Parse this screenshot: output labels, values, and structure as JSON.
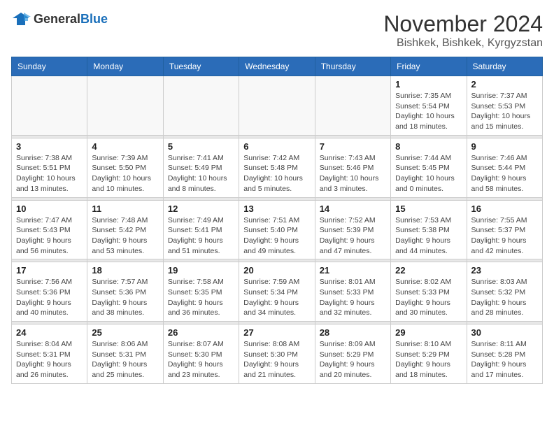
{
  "logo": {
    "text_general": "General",
    "text_blue": "Blue"
  },
  "title": {
    "month": "November 2024",
    "location": "Bishkek, Bishkek, Kyrgyzstan"
  },
  "headers": [
    "Sunday",
    "Monday",
    "Tuesday",
    "Wednesday",
    "Thursday",
    "Friday",
    "Saturday"
  ],
  "weeks": [
    [
      {
        "day": "",
        "info": ""
      },
      {
        "day": "",
        "info": ""
      },
      {
        "day": "",
        "info": ""
      },
      {
        "day": "",
        "info": ""
      },
      {
        "day": "",
        "info": ""
      },
      {
        "day": "1",
        "info": "Sunrise: 7:35 AM\nSunset: 5:54 PM\nDaylight: 10 hours and 18 minutes."
      },
      {
        "day": "2",
        "info": "Sunrise: 7:37 AM\nSunset: 5:53 PM\nDaylight: 10 hours and 15 minutes."
      }
    ],
    [
      {
        "day": "3",
        "info": "Sunrise: 7:38 AM\nSunset: 5:51 PM\nDaylight: 10 hours and 13 minutes."
      },
      {
        "day": "4",
        "info": "Sunrise: 7:39 AM\nSunset: 5:50 PM\nDaylight: 10 hours and 10 minutes."
      },
      {
        "day": "5",
        "info": "Sunrise: 7:41 AM\nSunset: 5:49 PM\nDaylight: 10 hours and 8 minutes."
      },
      {
        "day": "6",
        "info": "Sunrise: 7:42 AM\nSunset: 5:48 PM\nDaylight: 10 hours and 5 minutes."
      },
      {
        "day": "7",
        "info": "Sunrise: 7:43 AM\nSunset: 5:46 PM\nDaylight: 10 hours and 3 minutes."
      },
      {
        "day": "8",
        "info": "Sunrise: 7:44 AM\nSunset: 5:45 PM\nDaylight: 10 hours and 0 minutes."
      },
      {
        "day": "9",
        "info": "Sunrise: 7:46 AM\nSunset: 5:44 PM\nDaylight: 9 hours and 58 minutes."
      }
    ],
    [
      {
        "day": "10",
        "info": "Sunrise: 7:47 AM\nSunset: 5:43 PM\nDaylight: 9 hours and 56 minutes."
      },
      {
        "day": "11",
        "info": "Sunrise: 7:48 AM\nSunset: 5:42 PM\nDaylight: 9 hours and 53 minutes."
      },
      {
        "day": "12",
        "info": "Sunrise: 7:49 AM\nSunset: 5:41 PM\nDaylight: 9 hours and 51 minutes."
      },
      {
        "day": "13",
        "info": "Sunrise: 7:51 AM\nSunset: 5:40 PM\nDaylight: 9 hours and 49 minutes."
      },
      {
        "day": "14",
        "info": "Sunrise: 7:52 AM\nSunset: 5:39 PM\nDaylight: 9 hours and 47 minutes."
      },
      {
        "day": "15",
        "info": "Sunrise: 7:53 AM\nSunset: 5:38 PM\nDaylight: 9 hours and 44 minutes."
      },
      {
        "day": "16",
        "info": "Sunrise: 7:55 AM\nSunset: 5:37 PM\nDaylight: 9 hours and 42 minutes."
      }
    ],
    [
      {
        "day": "17",
        "info": "Sunrise: 7:56 AM\nSunset: 5:36 PM\nDaylight: 9 hours and 40 minutes."
      },
      {
        "day": "18",
        "info": "Sunrise: 7:57 AM\nSunset: 5:36 PM\nDaylight: 9 hours and 38 minutes."
      },
      {
        "day": "19",
        "info": "Sunrise: 7:58 AM\nSunset: 5:35 PM\nDaylight: 9 hours and 36 minutes."
      },
      {
        "day": "20",
        "info": "Sunrise: 7:59 AM\nSunset: 5:34 PM\nDaylight: 9 hours and 34 minutes."
      },
      {
        "day": "21",
        "info": "Sunrise: 8:01 AM\nSunset: 5:33 PM\nDaylight: 9 hours and 32 minutes."
      },
      {
        "day": "22",
        "info": "Sunrise: 8:02 AM\nSunset: 5:33 PM\nDaylight: 9 hours and 30 minutes."
      },
      {
        "day": "23",
        "info": "Sunrise: 8:03 AM\nSunset: 5:32 PM\nDaylight: 9 hours and 28 minutes."
      }
    ],
    [
      {
        "day": "24",
        "info": "Sunrise: 8:04 AM\nSunset: 5:31 PM\nDaylight: 9 hours and 26 minutes."
      },
      {
        "day": "25",
        "info": "Sunrise: 8:06 AM\nSunset: 5:31 PM\nDaylight: 9 hours and 25 minutes."
      },
      {
        "day": "26",
        "info": "Sunrise: 8:07 AM\nSunset: 5:30 PM\nDaylight: 9 hours and 23 minutes."
      },
      {
        "day": "27",
        "info": "Sunrise: 8:08 AM\nSunset: 5:30 PM\nDaylight: 9 hours and 21 minutes."
      },
      {
        "day": "28",
        "info": "Sunrise: 8:09 AM\nSunset: 5:29 PM\nDaylight: 9 hours and 20 minutes."
      },
      {
        "day": "29",
        "info": "Sunrise: 8:10 AM\nSunset: 5:29 PM\nDaylight: 9 hours and 18 minutes."
      },
      {
        "day": "30",
        "info": "Sunrise: 8:11 AM\nSunset: 5:28 PM\nDaylight: 9 hours and 17 minutes."
      }
    ]
  ]
}
